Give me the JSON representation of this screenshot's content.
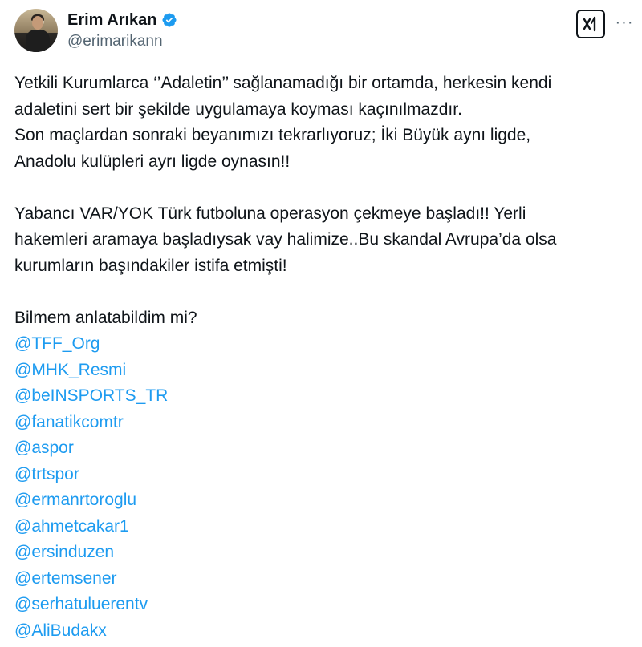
{
  "author": {
    "display_name": "Erim Arıkan",
    "handle": "@erimarikann",
    "verified": true,
    "verified_icon": "verified-badge-icon",
    "avatar_icon": "avatar"
  },
  "actions": {
    "grok_icon": "grok-icon",
    "more_label": "···"
  },
  "tweet": {
    "para1": [
      "Yetkili Kurumlarca ‘’Adaletin’’ sağlanamadığı bir ortamda, herkesin kendi",
      "adaletini sert bir şekilde uygulamaya koyması kaçınılmazdır.",
      "Son maçlardan sonraki beyanımızı tekrarlıyoruz; İki Büyük aynı ligde,",
      "Anadolu kulüpleri ayrı ligde oynasın!!"
    ],
    "para2": [
      "Yabancı VAR/YOK Türk futboluna operasyon çekmeye başladı!! Yerli",
      "hakemleri aramaya başladıysak vay halimize..Bu skandal Avrupa’da olsa",
      "kurumların başındakiler istifa etmişti!"
    ],
    "question": "Bilmem anlatabildim mi?",
    "mentions": [
      "@TFF_Org",
      "@MHK_Resmi",
      "@beINSPORTS_TR",
      "@fanatikcomtr",
      "@aspor",
      "@trtspor",
      "@ermanrtoroglu",
      "@ahmetcakar1",
      "@ersinduzen",
      "@ertemsener",
      "@serhatuluerentv",
      "@AliBudakx"
    ]
  },
  "colors": {
    "text": "#0f1419",
    "secondary": "#536471",
    "link": "#1d9bf0"
  }
}
